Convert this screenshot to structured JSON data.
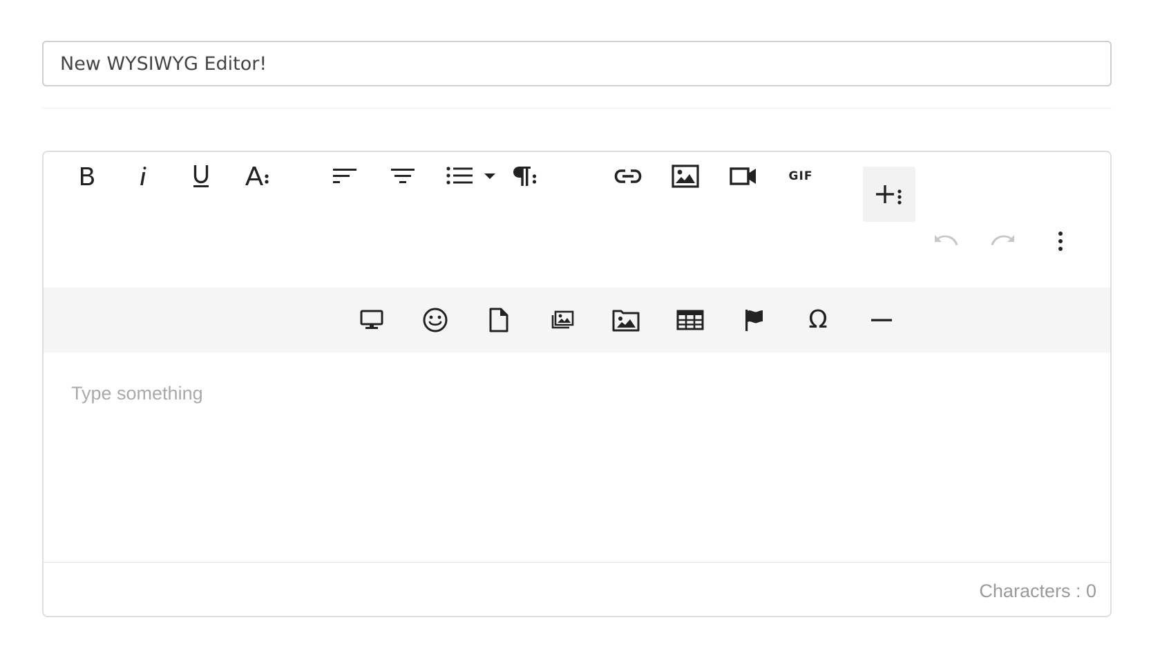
{
  "title_field": {
    "value": "New WYSIWYG Editor!"
  },
  "toolbar": {
    "row1": [
      {
        "name": "bold",
        "icon": "bold-icon"
      },
      {
        "name": "italic",
        "icon": "italic-icon"
      },
      {
        "name": "underline",
        "icon": "underline-icon"
      },
      {
        "name": "text-format-more",
        "icon": "font-more-icon"
      },
      {
        "name": "align-left",
        "icon": "align-left-icon"
      },
      {
        "name": "align-center",
        "icon": "align-center-icon"
      },
      {
        "name": "unordered-list",
        "icon": "list-icon"
      },
      {
        "name": "list-dropdown",
        "icon": "caret-down-icon"
      },
      {
        "name": "paragraph-more",
        "icon": "paragraph-more-icon"
      },
      {
        "name": "insert-link",
        "icon": "link-icon"
      },
      {
        "name": "insert-image",
        "icon": "image-icon"
      },
      {
        "name": "insert-video",
        "icon": "video-icon"
      },
      {
        "name": "insert-gif",
        "icon": "gif-icon",
        "label": "GIF"
      },
      {
        "name": "insert-more",
        "icon": "plus-more-icon",
        "active": true
      }
    ],
    "row2": [
      {
        "name": "undo",
        "icon": "undo-icon",
        "disabled": true
      },
      {
        "name": "redo",
        "icon": "redo-icon",
        "disabled": true
      },
      {
        "name": "more-misc",
        "icon": "more-vertical-icon"
      }
    ]
  },
  "secondary_toolbar": [
    {
      "name": "embed",
      "icon": "monitor-icon"
    },
    {
      "name": "emoticons",
      "icon": "smiley-icon"
    },
    {
      "name": "insert-file",
      "icon": "file-icon"
    },
    {
      "name": "image-manager",
      "icon": "gallery-icon"
    },
    {
      "name": "insert-image-folder",
      "icon": "image-folder-icon"
    },
    {
      "name": "insert-table",
      "icon": "table-icon"
    },
    {
      "name": "font-awesome",
      "icon": "flag-icon"
    },
    {
      "name": "special-characters",
      "icon": "omega-icon",
      "label": "Ω"
    },
    {
      "name": "insert-hr",
      "icon": "horizontal-rule-icon"
    }
  ],
  "editor": {
    "placeholder": "Type something"
  },
  "footer": {
    "char_count": "Characters : 0"
  },
  "colors": {
    "icon": "#222222",
    "icon_disabled": "#c7c7c7",
    "secondary_bar_bg": "#f5f5f5",
    "active_btn_bg": "#f2f2f2",
    "placeholder": "#a9a9a9",
    "counter": "#9a9a9a"
  }
}
